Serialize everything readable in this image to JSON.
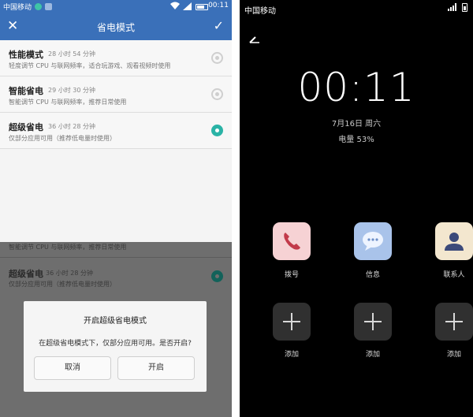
{
  "left": {
    "status": {
      "carrier": "中国移动",
      "time": "00:11"
    },
    "title": "省电模式",
    "modes": [
      {
        "name": "性能模式",
        "duration": "28 小时 54 分钟",
        "desc": "轻度调节 CPU 与联网频率，适合玩游戏、观看视频时使用",
        "selected": false
      },
      {
        "name": "智能省电",
        "duration": "29 小时 30 分钟",
        "desc": "智能调节 CPU 与联网频率，推荐日常使用",
        "selected": false
      },
      {
        "name": "超级省电",
        "duration": "36 小时 28 分钟",
        "desc": "仅部分应用可用（推荐低电量时使用）",
        "selected": true
      }
    ],
    "lower": {
      "partial_desc": "智能调节 CPU 与联网频率，推荐日常使用",
      "name": "超级省电",
      "duration": "36 小时 28 分钟",
      "desc": "仅部分应用可用（推荐低电量时使用）"
    },
    "dialog": {
      "title": "开启超级省电模式",
      "message": "在超级省电模式下，仅部分应用可用。是否开启?",
      "cancel": "取消",
      "confirm": "开启"
    },
    "colors": {
      "header": "#3a70b9",
      "radio_on": "#2bb3a6"
    }
  },
  "right": {
    "status": {
      "carrier": "中国移动"
    },
    "clock": "00:11",
    "date": "7月16日 周六",
    "battery": "电量 53%",
    "apps": [
      {
        "label": "拨号",
        "icon": "phone-icon"
      },
      {
        "label": "信息",
        "icon": "message-icon"
      },
      {
        "label": "联系人",
        "icon": "contacts-icon"
      }
    ],
    "add_label": "添加"
  }
}
